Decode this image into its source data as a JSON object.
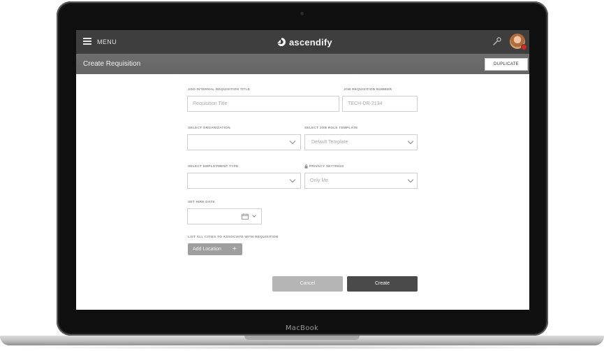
{
  "header": {
    "menu_label": "MENU",
    "logo_text": "ascendify"
  },
  "subheader": {
    "title": "Create Requisition",
    "duplicate_label": "DUPLICATE"
  },
  "form": {
    "requisition_title": {
      "label": "ADD INTERNAL REQUISITION TITLE",
      "placeholder": "Requisition Title"
    },
    "requisition_number": {
      "label": "JOB REQUISITION NUMBER",
      "value": "TECH-DR-2134"
    },
    "organization": {
      "label": "SELECT ORGANIZATION",
      "value": ""
    },
    "role_template": {
      "label": "SELECT JOB ROLE TEMPLATE",
      "value": "Default Template"
    },
    "employment_type": {
      "label": "SELECT EMPLOYMENT TYPE",
      "value": ""
    },
    "privacy": {
      "label": "PRIVACY SETTINGS",
      "value": "Only Me"
    },
    "hire_date": {
      "label": "SET HIRE DATE",
      "value": ""
    },
    "locations": {
      "label": "LIST ALL CITIES TO ASSOCIATE WITH REQUISITION",
      "add_label": "Add Location"
    },
    "cancel_label": "Cancel",
    "create_label": "Create"
  },
  "device": {
    "label": "MacBook"
  },
  "colors": {
    "topbar": "#3e3e3e",
    "subbar": "#696969",
    "create_button": "#4a4a4a",
    "cancel_button": "#b5b5b5"
  }
}
